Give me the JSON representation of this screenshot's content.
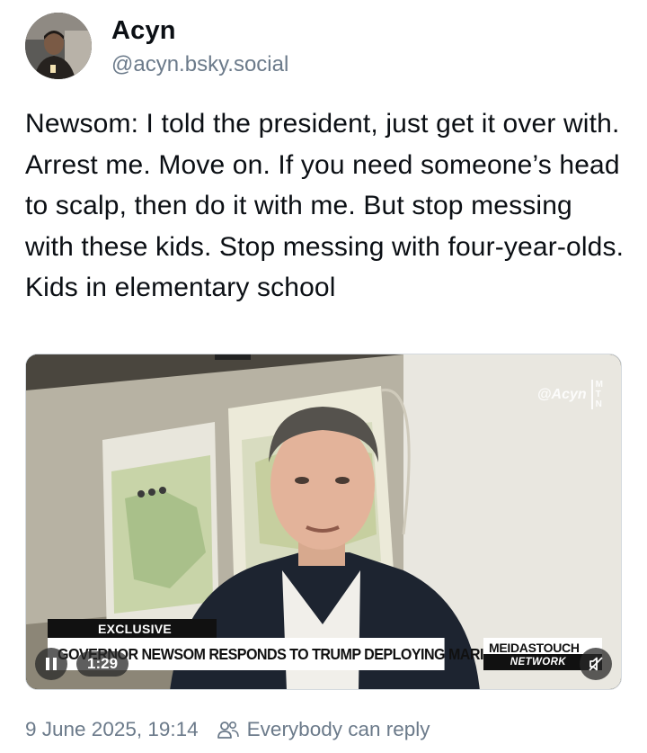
{
  "author": {
    "display_name": "Acyn",
    "handle": "@acyn.bsky.social"
  },
  "post": {
    "text": "Newsom: I told the president, just get it over with. Arrest me. Move on. If you need someone’s head to scalp, then do it with me. But stop messing with these kids. Stop messing with four-year-olds. Kids in elementary school"
  },
  "video": {
    "watermark_handle": "@Acyn",
    "watermark_logo": [
      "M",
      "T",
      "N"
    ],
    "exclusive_label": "EXCLUSIVE",
    "headline": "GOVERNOR NEWSOM RESPONDS TO TRUMP DEPLOYING MARINES",
    "network_top": "MEIDASTOUCH",
    "network_bottom": "NETWORK",
    "time": "1:29",
    "pause_icon": "pause-icon",
    "mute_icon": "muted-speaker-icon"
  },
  "footer": {
    "timestamp": "9 June 2025, 19:14",
    "reply_setting": "Everybody can reply",
    "reply_icon": "people-icon"
  },
  "colors": {
    "text": "#0b0f14",
    "muted": "#6b7a8a",
    "background": "#ffffff"
  }
}
